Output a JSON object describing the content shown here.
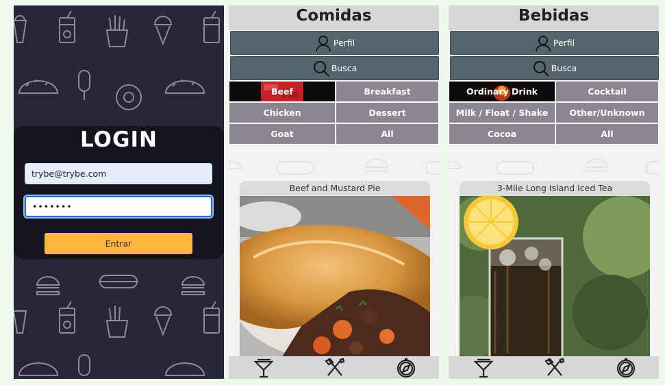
{
  "login": {
    "title": "LOGIN",
    "email_value": "trybe@trybe.com",
    "password_value": "•••••••",
    "submit_label": "Entrar",
    "colors": {
      "panel": "#2b2538",
      "button": "#fdb63b"
    }
  },
  "foods": {
    "header": "Comidas",
    "profile_label": "Perfil",
    "search_label": "Busca",
    "categories": [
      {
        "label": "Beef",
        "active": true
      },
      {
        "label": "Breakfast"
      },
      {
        "label": "Chicken"
      },
      {
        "label": "Dessert"
      },
      {
        "label": "Goat"
      },
      {
        "label": "All"
      }
    ],
    "recipe_name": "Beef and Mustard Pie"
  },
  "drinks": {
    "header": "Bebidas",
    "profile_label": "Perfil",
    "search_label": "Busca",
    "categories": [
      {
        "label": "Ordinary Drink",
        "active": true
      },
      {
        "label": "Cocktail"
      },
      {
        "label": "Milk / Float / Shake"
      },
      {
        "label": "Other/Unknown"
      },
      {
        "label": "Cocoa"
      },
      {
        "label": "All"
      }
    ],
    "recipe_name": "3-Mile Long Island Iced Tea"
  },
  "icons": [
    "profile-icon",
    "search-icon",
    "drink-icon",
    "fork-knife-icon",
    "compass-icon"
  ],
  "colors": {
    "nav_button": "#56656c",
    "category": "#8c8592",
    "active_category": "#0c0c0c"
  }
}
